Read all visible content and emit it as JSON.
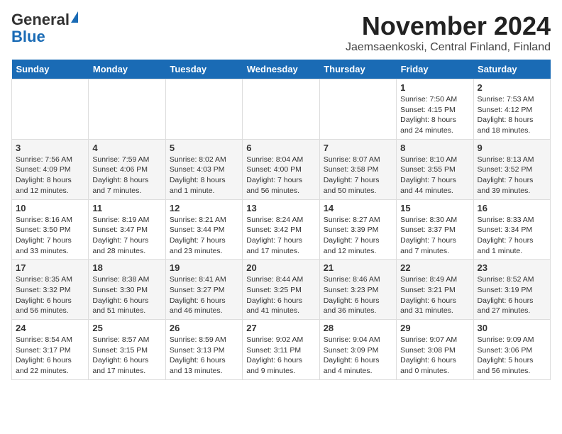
{
  "logo": {
    "general": "General",
    "blue": "Blue"
  },
  "title": {
    "month": "November 2024",
    "location": "Jaemsaenkoski, Central Finland, Finland"
  },
  "headers": [
    "Sunday",
    "Monday",
    "Tuesday",
    "Wednesday",
    "Thursday",
    "Friday",
    "Saturday"
  ],
  "weeks": [
    [
      {
        "day": "",
        "info": ""
      },
      {
        "day": "",
        "info": ""
      },
      {
        "day": "",
        "info": ""
      },
      {
        "day": "",
        "info": ""
      },
      {
        "day": "",
        "info": ""
      },
      {
        "day": "1",
        "info": "Sunrise: 7:50 AM\nSunset: 4:15 PM\nDaylight: 8 hours and 24 minutes."
      },
      {
        "day": "2",
        "info": "Sunrise: 7:53 AM\nSunset: 4:12 PM\nDaylight: 8 hours and 18 minutes."
      }
    ],
    [
      {
        "day": "3",
        "info": "Sunrise: 7:56 AM\nSunset: 4:09 PM\nDaylight: 8 hours and 12 minutes."
      },
      {
        "day": "4",
        "info": "Sunrise: 7:59 AM\nSunset: 4:06 PM\nDaylight: 8 hours and 7 minutes."
      },
      {
        "day": "5",
        "info": "Sunrise: 8:02 AM\nSunset: 4:03 PM\nDaylight: 8 hours and 1 minute."
      },
      {
        "day": "6",
        "info": "Sunrise: 8:04 AM\nSunset: 4:00 PM\nDaylight: 7 hours and 56 minutes."
      },
      {
        "day": "7",
        "info": "Sunrise: 8:07 AM\nSunset: 3:58 PM\nDaylight: 7 hours and 50 minutes."
      },
      {
        "day": "8",
        "info": "Sunrise: 8:10 AM\nSunset: 3:55 PM\nDaylight: 7 hours and 44 minutes."
      },
      {
        "day": "9",
        "info": "Sunrise: 8:13 AM\nSunset: 3:52 PM\nDaylight: 7 hours and 39 minutes."
      }
    ],
    [
      {
        "day": "10",
        "info": "Sunrise: 8:16 AM\nSunset: 3:50 PM\nDaylight: 7 hours and 33 minutes."
      },
      {
        "day": "11",
        "info": "Sunrise: 8:19 AM\nSunset: 3:47 PM\nDaylight: 7 hours and 28 minutes."
      },
      {
        "day": "12",
        "info": "Sunrise: 8:21 AM\nSunset: 3:44 PM\nDaylight: 7 hours and 23 minutes."
      },
      {
        "day": "13",
        "info": "Sunrise: 8:24 AM\nSunset: 3:42 PM\nDaylight: 7 hours and 17 minutes."
      },
      {
        "day": "14",
        "info": "Sunrise: 8:27 AM\nSunset: 3:39 PM\nDaylight: 7 hours and 12 minutes."
      },
      {
        "day": "15",
        "info": "Sunrise: 8:30 AM\nSunset: 3:37 PM\nDaylight: 7 hours and 7 minutes."
      },
      {
        "day": "16",
        "info": "Sunrise: 8:33 AM\nSunset: 3:34 PM\nDaylight: 7 hours and 1 minute."
      }
    ],
    [
      {
        "day": "17",
        "info": "Sunrise: 8:35 AM\nSunset: 3:32 PM\nDaylight: 6 hours and 56 minutes."
      },
      {
        "day": "18",
        "info": "Sunrise: 8:38 AM\nSunset: 3:30 PM\nDaylight: 6 hours and 51 minutes."
      },
      {
        "day": "19",
        "info": "Sunrise: 8:41 AM\nSunset: 3:27 PM\nDaylight: 6 hours and 46 minutes."
      },
      {
        "day": "20",
        "info": "Sunrise: 8:44 AM\nSunset: 3:25 PM\nDaylight: 6 hours and 41 minutes."
      },
      {
        "day": "21",
        "info": "Sunrise: 8:46 AM\nSunset: 3:23 PM\nDaylight: 6 hours and 36 minutes."
      },
      {
        "day": "22",
        "info": "Sunrise: 8:49 AM\nSunset: 3:21 PM\nDaylight: 6 hours and 31 minutes."
      },
      {
        "day": "23",
        "info": "Sunrise: 8:52 AM\nSunset: 3:19 PM\nDaylight: 6 hours and 27 minutes."
      }
    ],
    [
      {
        "day": "24",
        "info": "Sunrise: 8:54 AM\nSunset: 3:17 PM\nDaylight: 6 hours and 22 minutes."
      },
      {
        "day": "25",
        "info": "Sunrise: 8:57 AM\nSunset: 3:15 PM\nDaylight: 6 hours and 17 minutes."
      },
      {
        "day": "26",
        "info": "Sunrise: 8:59 AM\nSunset: 3:13 PM\nDaylight: 6 hours and 13 minutes."
      },
      {
        "day": "27",
        "info": "Sunrise: 9:02 AM\nSunset: 3:11 PM\nDaylight: 6 hours and 9 minutes."
      },
      {
        "day": "28",
        "info": "Sunrise: 9:04 AM\nSunset: 3:09 PM\nDaylight: 6 hours and 4 minutes."
      },
      {
        "day": "29",
        "info": "Sunrise: 9:07 AM\nSunset: 3:08 PM\nDaylight: 6 hours and 0 minutes."
      },
      {
        "day": "30",
        "info": "Sunrise: 9:09 AM\nSunset: 3:06 PM\nDaylight: 5 hours and 56 minutes."
      }
    ]
  ]
}
